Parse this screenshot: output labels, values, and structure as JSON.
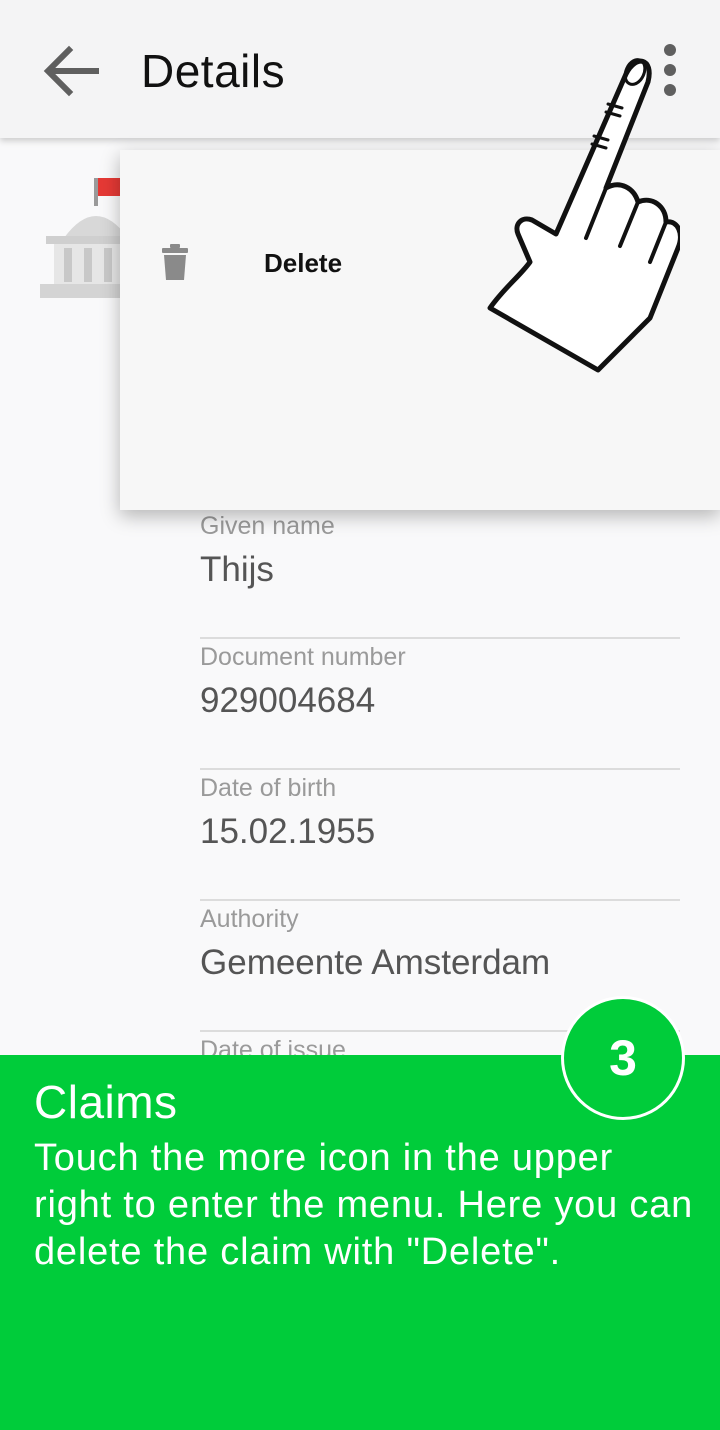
{
  "appbar": {
    "title": "Details"
  },
  "menu": {
    "items": [
      {
        "label": "Delete",
        "icon": "trash-icon"
      }
    ]
  },
  "fields": [
    {
      "label": "Given name",
      "value": "Thijs"
    },
    {
      "label": "Document number",
      "value": "929004684"
    },
    {
      "label": "Date of birth",
      "value": "15.02.1955"
    },
    {
      "label": "Authority",
      "value": "Gemeente Amsterdam"
    },
    {
      "label": "Date of issue",
      "value": ""
    }
  ],
  "tutorial": {
    "step": "3",
    "title": "Claims",
    "text": "Touch the more icon in the upper right to enter the menu. Here you can delete the claim with \"Delete\"."
  },
  "colors": {
    "overlay": "#00cc3a",
    "flag": "#e53935",
    "icon_gray": "#5f5f5f"
  },
  "icons": [
    "back-arrow-icon",
    "more-vert-icon",
    "issuer-building-icon",
    "trash-icon",
    "pointing-hand-icon"
  ]
}
